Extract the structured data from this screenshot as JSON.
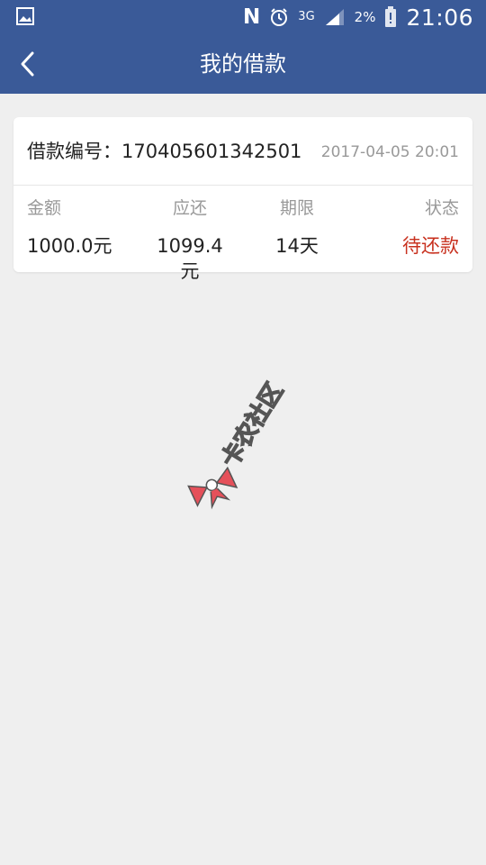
{
  "status_bar": {
    "battery_percent": "2%",
    "network": "3G",
    "time": "21:06",
    "n_label": "N",
    "icons": [
      "gallery-icon",
      "nfc-icon",
      "alarm-icon",
      "signal-icon",
      "battery-alert-icon"
    ]
  },
  "nav": {
    "back_icon": "chevron-left-icon",
    "title": "我的借款"
  },
  "loan": {
    "number_label": "借款编号：",
    "number": "170405601342501",
    "datetime": "2017-04-05 20:01",
    "columns": [
      {
        "label": "金额",
        "value": "1000.0元"
      },
      {
        "label": "应还",
        "value": "1099.4元"
      },
      {
        "label": "期限",
        "value": "14天"
      },
      {
        "label": "状态",
        "value": "待还款"
      }
    ]
  },
  "watermark": {
    "text": "卡农社区"
  },
  "colors": {
    "header_bg": "#3a5a98",
    "page_bg": "#efefef",
    "status_red": "#c8311f",
    "muted_text": "#999999"
  }
}
